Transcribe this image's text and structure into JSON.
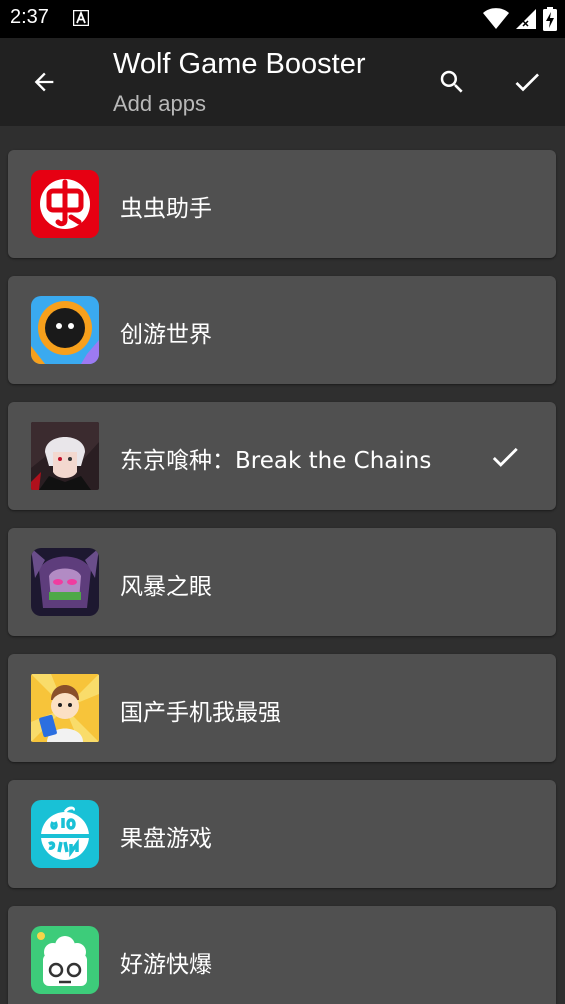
{
  "status_bar": {
    "time": "2:37"
  },
  "app_bar": {
    "title": "Wolf Game Booster",
    "subtitle": "Add apps"
  },
  "apps": [
    {
      "name": "虫虫助手",
      "selected": false,
      "icon": "chongchong-icon"
    },
    {
      "name": "创游世界",
      "selected": false,
      "icon": "chuangyou-icon"
    },
    {
      "name": "东京喰种：Break the Chains",
      "selected": true,
      "icon": "tokyo-ghoul-icon"
    },
    {
      "name": "风暴之眼",
      "selected": false,
      "icon": "storm-eye-icon"
    },
    {
      "name": "国产手机我最强",
      "selected": false,
      "icon": "guochan-phone-icon"
    },
    {
      "name": "果盘游戏",
      "selected": false,
      "icon": "guopan-icon"
    },
    {
      "name": "好游快爆",
      "selected": false,
      "icon": "haoyou-icon"
    }
  ],
  "colors": {
    "background": "#2f2f2f",
    "app_bar": "#212121",
    "card": "#505050",
    "status_bar": "#000000"
  }
}
